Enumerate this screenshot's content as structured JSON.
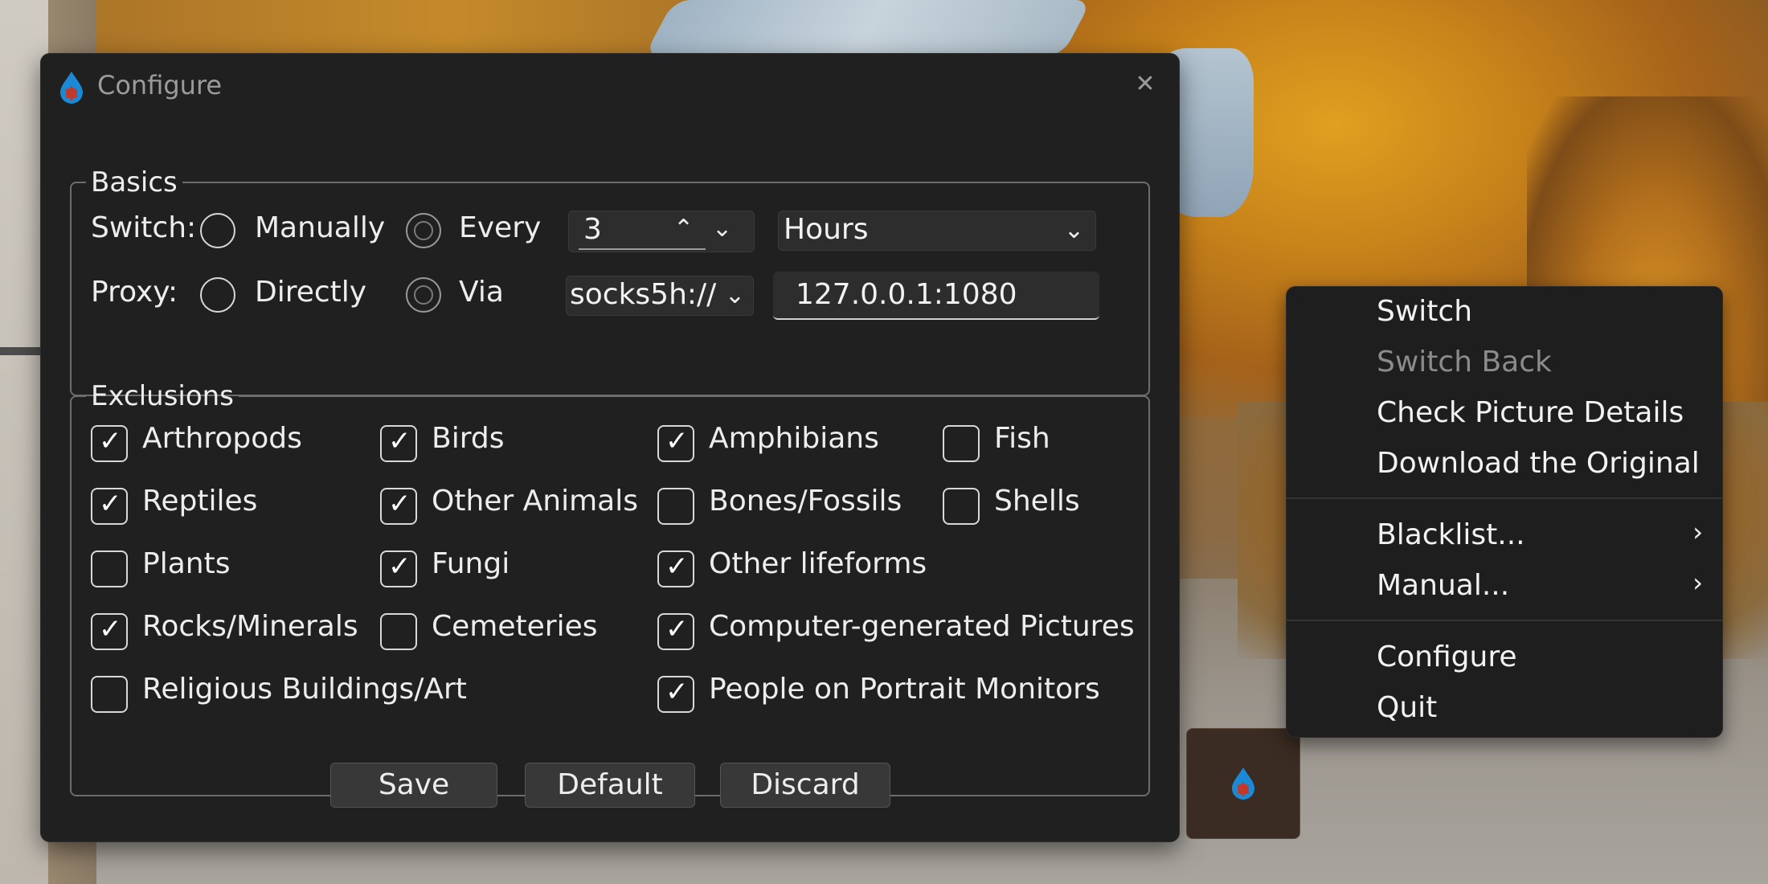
{
  "dialog": {
    "title": "Configure",
    "close_glyph": "✕",
    "basics": {
      "legend": "Basics",
      "switch_label": "Switch:",
      "switch_options": [
        "Manually",
        "Every"
      ],
      "switch_selected": "Every",
      "interval_value": "3",
      "interval_unit": "Hours",
      "proxy_label": "Proxy:",
      "proxy_options": [
        "Directly",
        "Via"
      ],
      "proxy_selected": "Via",
      "proxy_scheme": "socks5h://",
      "proxy_address": "127.0.0.1:1080"
    },
    "exclusions": {
      "legend": "Exclusions",
      "items": [
        {
          "label": "Arthropods",
          "checked": true
        },
        {
          "label": "Birds",
          "checked": true
        },
        {
          "label": "Amphibians",
          "checked": true
        },
        {
          "label": "Fish",
          "checked": false
        },
        {
          "label": "Reptiles",
          "checked": true
        },
        {
          "label": "Other Animals",
          "checked": true
        },
        {
          "label": "Bones/Fossils",
          "checked": false
        },
        {
          "label": "Shells",
          "checked": false
        },
        {
          "label": "Plants",
          "checked": false
        },
        {
          "label": "Fungi",
          "checked": true
        },
        {
          "label": "Other lifeforms",
          "checked": true
        },
        {
          "label": "Rocks/Minerals",
          "checked": true
        },
        {
          "label": "Cemeteries",
          "checked": false
        },
        {
          "label": "Computer-generated Pictures",
          "checked": true
        },
        {
          "label": "Religious Buildings/Art",
          "checked": false
        },
        {
          "label": "People on Portrait Monitors",
          "checked": true
        }
      ]
    },
    "buttons": {
      "save": "Save",
      "default": "Default",
      "discard": "Discard"
    }
  },
  "context_menu": {
    "items": [
      {
        "label": "Switch",
        "enabled": true
      },
      {
        "label": "Switch Back",
        "enabled": false
      },
      {
        "label": "Check Picture Details",
        "enabled": true
      },
      {
        "label": "Download the Original",
        "enabled": true
      },
      {
        "label": "Blacklist...",
        "enabled": true,
        "submenu": true
      },
      {
        "label": "Manual...",
        "enabled": true,
        "submenu": true
      },
      {
        "label": "Configure",
        "enabled": true
      },
      {
        "label": "Quit",
        "enabled": true
      }
    ],
    "submenu_glyph": "›"
  },
  "icons": {
    "app": "water-drop-icon",
    "chevron_up": "^",
    "chevron_down": "⌄"
  },
  "colors": {
    "dialog_bg": "#202020",
    "menu_bg": "#1e1e1e",
    "accent_icon_blue": "#1b8ad6",
    "accent_icon_red": "#c0392b"
  }
}
